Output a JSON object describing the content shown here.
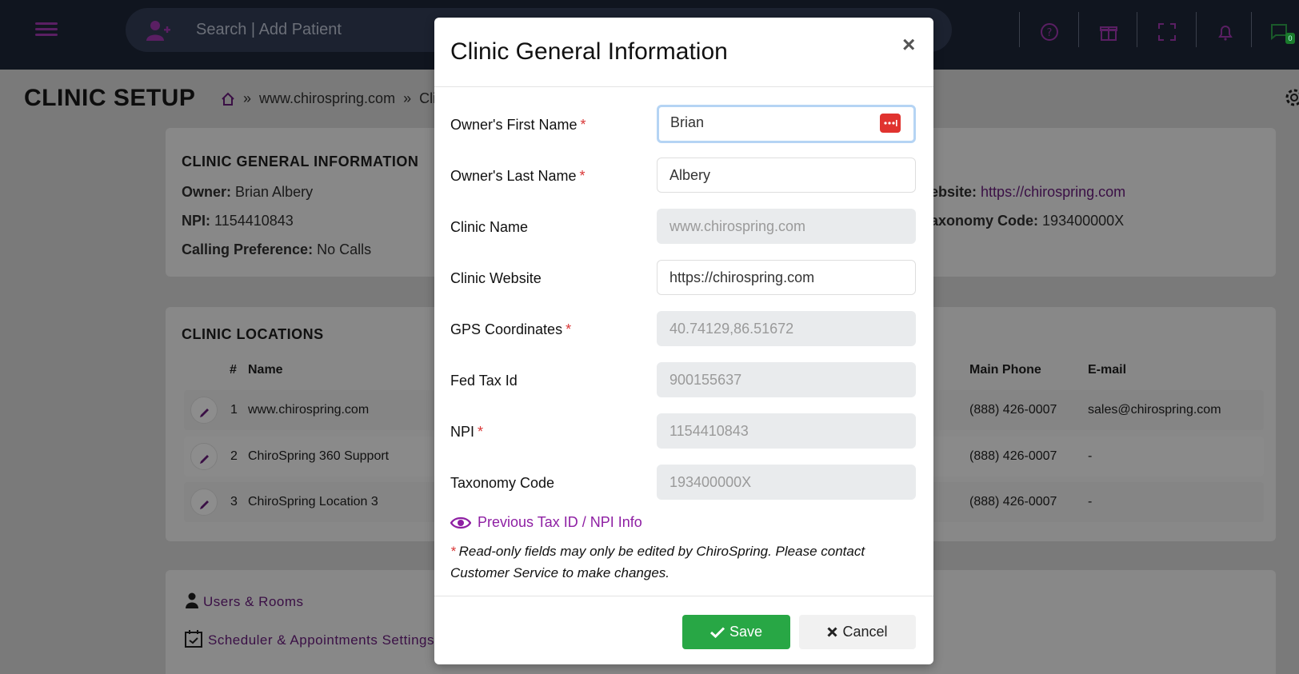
{
  "topbar": {
    "search_placeholder": "Search | Add Patient",
    "message_badge": "0"
  },
  "page": {
    "title": "CLINIC SETUP",
    "breadcrumb": [
      "www.chirospring.com",
      "Clin"
    ],
    "separator": "»"
  },
  "general_card": {
    "title": "CLINIC GENERAL INFORMATION",
    "owner_label": "Owner:",
    "owner_value": "Brian Albery",
    "npi_label": "NPI:",
    "npi_value": "1154410843",
    "calling_label": "Calling Preference:",
    "calling_value": "No Calls",
    "website_label": "ebsite:",
    "website_value": "https://chirospring.com",
    "taxonomy_label": "axonomy Code:",
    "taxonomy_value": "193400000X"
  },
  "locations_card": {
    "title": "CLINIC LOCATIONS",
    "headers": {
      "num": "#",
      "name": "Name",
      "phone": "Main Phone",
      "email": "E-mail"
    },
    "rows": [
      {
        "num": "1",
        "name": "www.chirospring.com",
        "phone": "(888) 426-0007",
        "email": "sales@chirospring.com"
      },
      {
        "num": "2",
        "name": "ChiroSpring 360 Support",
        "phone": "(888) 426-0007",
        "email": "-"
      },
      {
        "num": "3",
        "name": "ChiroSpring Location 3",
        "phone": "(888) 426-0007",
        "email": "-"
      }
    ]
  },
  "settings_menu": {
    "users": "Users & Rooms",
    "scheduler": "Scheduler & Appointments Settings"
  },
  "modal": {
    "title": "Clinic General Information",
    "close": "×",
    "fields": {
      "first_name": {
        "label": "Owner's First Name",
        "required": "*",
        "value": "Brian"
      },
      "last_name": {
        "label": "Owner's Last Name",
        "required": "*",
        "value": "Albery"
      },
      "clinic_name": {
        "label": "Clinic Name",
        "value": "www.chirospring.com"
      },
      "website": {
        "label": "Clinic Website",
        "value": "https://chirospring.com"
      },
      "gps": {
        "label": "GPS Coordinates",
        "required": "*",
        "value": "40.74129,86.51672"
      },
      "fed_tax": {
        "label": "Fed Tax Id",
        "value": "900155637"
      },
      "npi": {
        "label": "NPI",
        "required": "*",
        "value": "1154410843"
      },
      "taxonomy": {
        "label": "Taxonomy Code",
        "value": "193400000X"
      }
    },
    "prev_link": "Previous Tax ID / NPI Info",
    "note_star": "*",
    "note": "Read-only fields may only be edited by ChiroSpring. Please contact Customer Service to make changes.",
    "save": "Save",
    "cancel": "Cancel"
  },
  "colors": {
    "accent": "#8e1fa3",
    "save": "#28a745",
    "required": "#d93636"
  }
}
